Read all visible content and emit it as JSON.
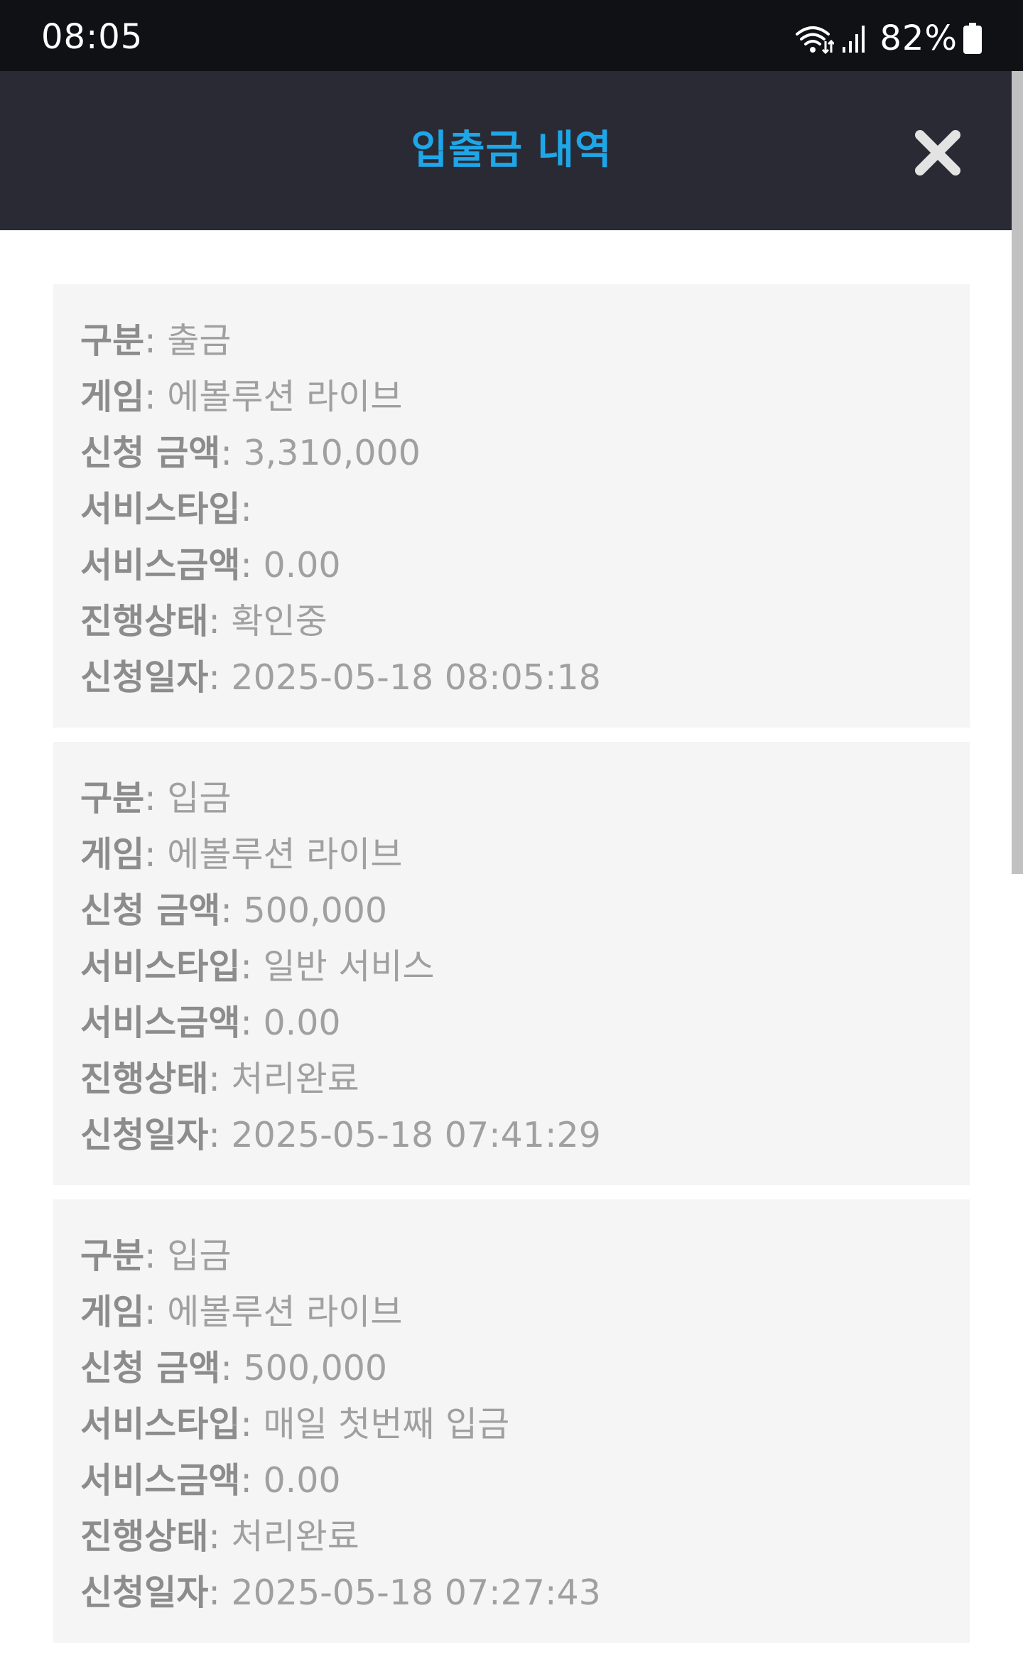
{
  "colors": {
    "status_bar_bg": "#101114",
    "header_bg": "#2a2a35",
    "title_accent": "#1ea7e8",
    "close_icon": "#e3e3e3",
    "card_bg": "#f5f5f5",
    "label_color": "#8c8c8c",
    "value_color": "#a0a0a0"
  },
  "status_bar": {
    "time": "08:05",
    "battery_percent": "82%",
    "icons": [
      "wifi-icon",
      "signal-icon",
      "battery-icon"
    ]
  },
  "header": {
    "title": "입출금 내역",
    "close_icon": "close-icon"
  },
  "labels": {
    "type": "구분",
    "game": "게임",
    "amount": "신청 금액",
    "service_type": "서비스타입",
    "service_amount": "서비스금액",
    "status": "진행상태",
    "date": "신청일자",
    "separator": ": "
  },
  "records": [
    {
      "type": "출금",
      "game": "에볼루션 라이브",
      "amount": "3,310,000",
      "service_type": "",
      "service_amount": "0.00",
      "status": "확인중",
      "date": "2025-05-18 08:05:18"
    },
    {
      "type": "입금",
      "game": "에볼루션 라이브",
      "amount": "500,000",
      "service_type": "일반 서비스",
      "service_amount": "0.00",
      "status": "처리완료",
      "date": "2025-05-18 07:41:29"
    },
    {
      "type": "입금",
      "game": "에볼루션 라이브",
      "amount": "500,000",
      "service_type": "매일 첫번째 입금",
      "service_amount": "0.00",
      "status": "처리완료",
      "date": "2025-05-18 07:27:43"
    }
  ]
}
